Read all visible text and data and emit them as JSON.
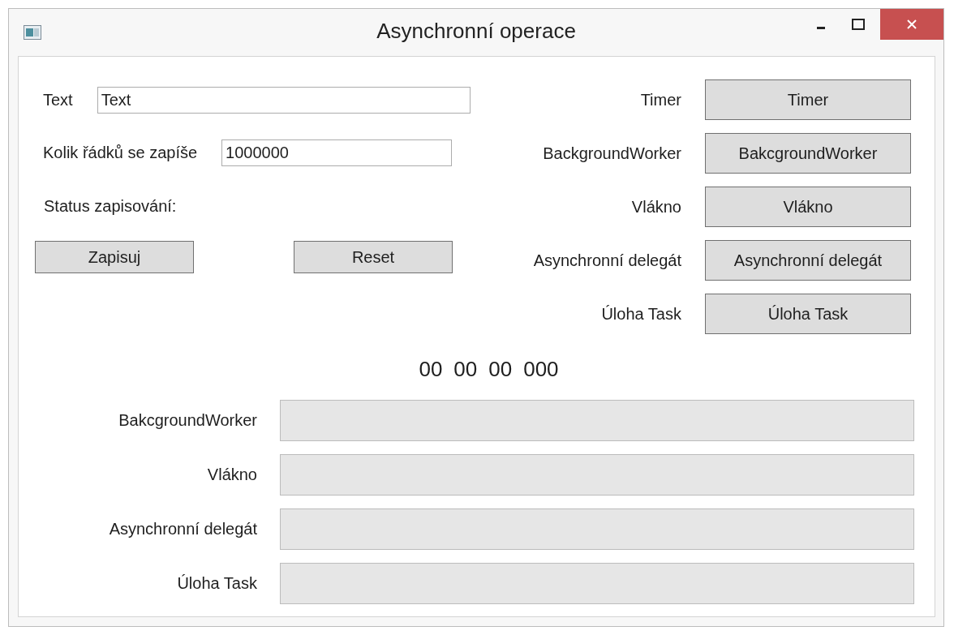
{
  "window": {
    "title": "Asynchronní operace"
  },
  "fields": [
    {
      "label": "Text",
      "value": "Text"
    },
    {
      "label": "Kolik řádků se zapíše",
      "value": "1000000"
    }
  ],
  "status_label": "Status zapisování:",
  "left_buttons": [
    "Zapisuj",
    "Reset"
  ],
  "methods": [
    {
      "label": "Timer",
      "button": "Timer"
    },
    {
      "label": "BackgroundWorker",
      "button": "BakcgroundWorker"
    },
    {
      "label": "Vlákno",
      "button": "Vlákno"
    },
    {
      "label": "Asynchronní delegát",
      "button": "Asynchronní delegát"
    },
    {
      "label": "Úloha Task",
      "button": "Úloha Task"
    }
  ],
  "timer": [
    "00",
    "00",
    "00",
    "000"
  ],
  "progress": [
    {
      "label": "BakcgroundWorker"
    },
    {
      "label": "Vlákno"
    },
    {
      "label": "Asynchronní delegát"
    },
    {
      "label": "Úloha Task"
    }
  ]
}
